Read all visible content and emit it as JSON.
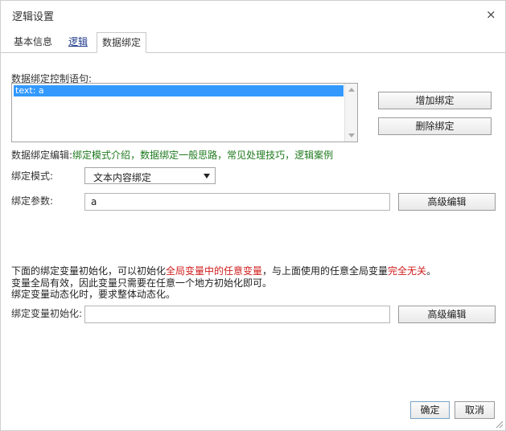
{
  "window": {
    "title": "逻辑设置",
    "close_icon": "×"
  },
  "tabs": [
    {
      "label": "基本信息"
    },
    {
      "label": "逻辑"
    },
    {
      "label": "数据绑定"
    }
  ],
  "binding_statements": {
    "label": "数据绑定控制语句:",
    "items": [
      "text: a"
    ]
  },
  "buttons": {
    "add_binding": "增加绑定",
    "delete_binding": "删除绑定",
    "advanced_edit_1": "高级编辑",
    "advanced_edit_2": "高级编辑",
    "ok": "确定",
    "cancel": "取消"
  },
  "binding_editor": {
    "prefix": "数据绑定编辑:",
    "links": [
      "绑定模式介绍",
      "数据绑定一般思路",
      "常见处理技巧",
      "逻辑案例"
    ],
    "separator": "，"
  },
  "binding_mode": {
    "label": "绑定模式:",
    "selected": "文本内容绑定"
  },
  "binding_params": {
    "label": "绑定参数:",
    "value": "a"
  },
  "notes": {
    "line1_a": "下面的绑定变量初始化，可以初始化",
    "line1_b": "全局变量中的任意变量",
    "line1_c": "，与上面使用的任意全局变量",
    "line1_d": "完全无关",
    "line1_e": "。",
    "line2": "变量全局有效，因此变量只需要在任意一个地方初始化即可。",
    "line3": "绑定变量动态化时，要求整体动态化。"
  },
  "binding_var_init": {
    "label": "绑定变量初始化:",
    "value": ""
  }
}
